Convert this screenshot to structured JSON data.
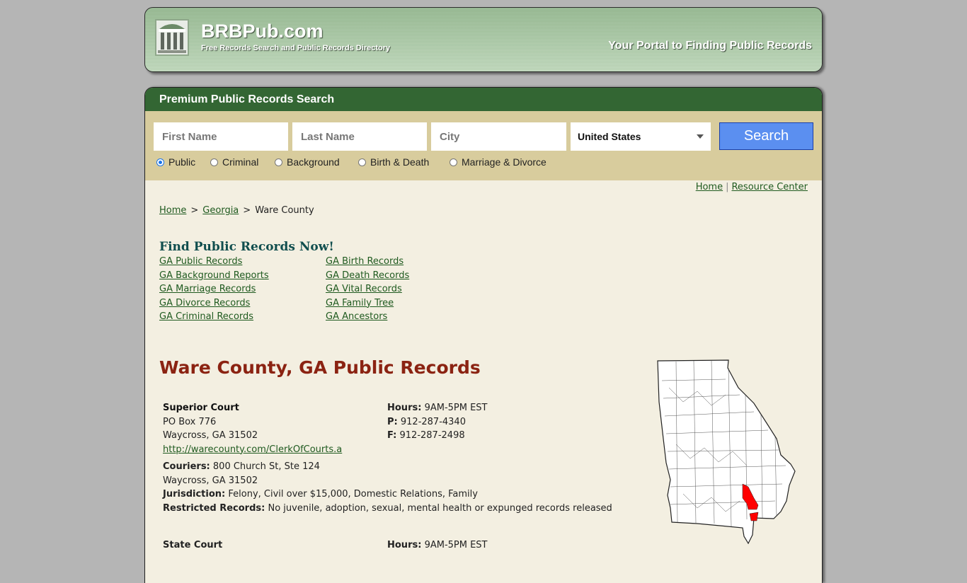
{
  "header": {
    "site_name": "BRBPub.com",
    "tagline": "Free Records Search and Public Records Directory",
    "portal_text": "Your Portal to Finding Public Records",
    "logo_icon": "courthouse-icon"
  },
  "search": {
    "title": "Premium Public Records Search",
    "first_name_placeholder": "First Name",
    "last_name_placeholder": "Last Name",
    "city_placeholder": "City",
    "country_selected": "United States",
    "search_button": "Search",
    "radios": [
      {
        "label": "Public",
        "checked": true
      },
      {
        "label": "Criminal",
        "checked": false
      },
      {
        "label": "Background",
        "checked": false
      },
      {
        "label": "Birth & Death",
        "checked": false
      },
      {
        "label": "Marriage & Divorce",
        "checked": false
      }
    ]
  },
  "top_links": {
    "home": "Home",
    "separator": "|",
    "resource_center": "Resource Center"
  },
  "breadcrumb": {
    "home": "Home",
    "sep": ">",
    "state": "Georgia",
    "current": "Ware County"
  },
  "find_records": {
    "heading": "Find Public Records Now!",
    "col1": [
      "GA Public Records",
      "GA Background Reports",
      "GA Marriage Records",
      "GA Divorce Records",
      "GA Criminal Records"
    ],
    "col2": [
      "GA Birth Records",
      "GA Death Records",
      "GA Vital Records",
      "GA Family Tree",
      "GA Ancestors"
    ]
  },
  "county": {
    "title": "Ware County, GA Public Records",
    "map_icon": "georgia-county-map",
    "highlight_color": "#ff0000"
  },
  "courts": [
    {
      "name": "Superior Court",
      "address1": "PO Box 776",
      "address2": "Waycross, GA 31502",
      "url": "http://warecounty.com/ClerkOfCourts.a",
      "hours_label": "Hours:",
      "hours": "9AM-5PM EST",
      "phone_label": "P:",
      "phone": "912-287-4340",
      "fax_label": "F:",
      "fax": "912-287-2498",
      "couriers_label": "Couriers:",
      "couriers1": "800 Church St, Ste 124",
      "couriers2": "Waycross, GA 31502",
      "jurisdiction_label": "Jurisdiction:",
      "jurisdiction": "Felony, Civil over $15,000, Domestic Relations, Family",
      "restricted_label": "Restricted Records:",
      "restricted": "No juvenile, adoption, sexual, mental health or expunged records released"
    },
    {
      "name": "State Court",
      "hours_label": "Hours:",
      "hours": "9AM-5PM EST"
    }
  ]
}
